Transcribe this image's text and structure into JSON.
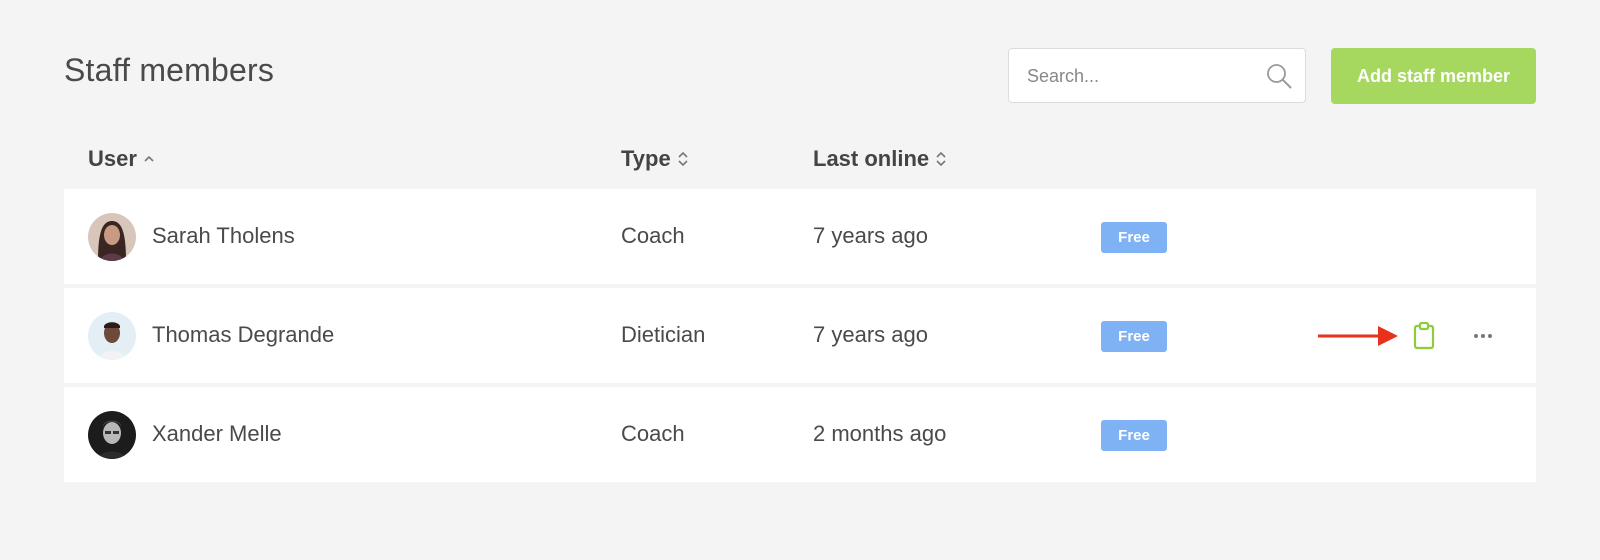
{
  "header": {
    "title": "Staff members",
    "search_placeholder": "Search...",
    "search_value": "",
    "add_button_label": "Add staff member"
  },
  "table": {
    "columns": [
      {
        "label": "User",
        "sort": "ascending",
        "sort_icon": "chevron-up-icon"
      },
      {
        "label": "Type",
        "sort": "none",
        "sort_icon": "sort-icon"
      },
      {
        "label": "Last online",
        "sort": "none",
        "sort_icon": "sort-icon"
      }
    ],
    "rows": [
      {
        "name": "Sarah Tholens",
        "type": "Coach",
        "last_online": "7 years ago",
        "badge": "Free",
        "avatar": "avatar-photo"
      },
      {
        "name": "Thomas Degrande",
        "type": "Dietician",
        "last_online": "7 years ago",
        "badge": "Free",
        "avatar": "avatar-photo",
        "actions": [
          "clipboard-icon",
          "more-icon"
        ],
        "annotation": "red-arrow-icon"
      },
      {
        "name": "Xander Melle",
        "type": "Coach",
        "last_online": "2 months ago",
        "badge": "Free",
        "avatar": "avatar-photo"
      }
    ]
  },
  "colors": {
    "background": "#f4f4f4",
    "accent_green": "#a6d75f",
    "badge_blue": "#7fb2f5",
    "arrow_red": "#e8321c",
    "text": "#444444"
  }
}
